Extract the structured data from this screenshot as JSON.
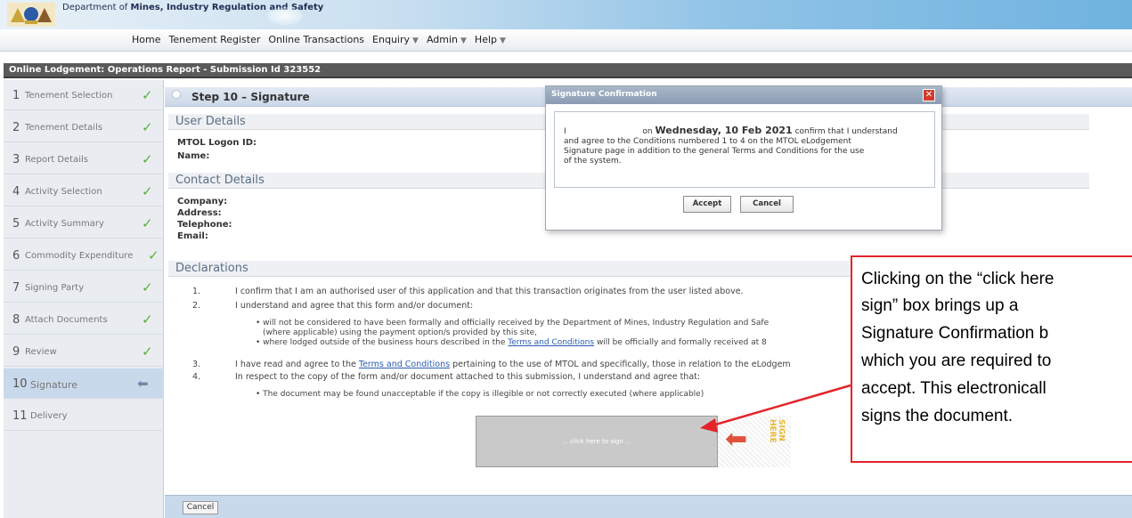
{
  "banner": {
    "dept_prefix": "Department of",
    "dept_name": "Mines, Industry Regulation and Safety"
  },
  "nav": {
    "items": [
      "Home",
      "Tenement Register",
      "Online Transactions",
      "Enquiry",
      "Admin",
      "Help"
    ]
  },
  "title": "Online Lodgement: Operations Report - Submission Id 323552",
  "sidebar": {
    "steps": [
      {
        "num": "1",
        "label": "Tenement Selection"
      },
      {
        "num": "2",
        "label": "Tenement Details"
      },
      {
        "num": "3",
        "label": "Report Details"
      },
      {
        "num": "4",
        "label": "Activity Selection"
      },
      {
        "num": "5",
        "label": "Activity Summary"
      },
      {
        "num": "6",
        "label": "Commodity Expenditure"
      },
      {
        "num": "7",
        "label": "Signing Party"
      },
      {
        "num": "8",
        "label": "Attach Documents"
      },
      {
        "num": "9",
        "label": "Review"
      },
      {
        "num": "10",
        "label": "Signature"
      },
      {
        "num": "11",
        "label": "Delivery"
      }
    ]
  },
  "main": {
    "step_heading": "Step 10 – Signature",
    "user_details": {
      "heading": "User Details",
      "logon_label": "MTOL Logon ID:",
      "name_label": "Name:"
    },
    "contact_details": {
      "heading": "Contact Details",
      "company_label": "Company:",
      "address_label": "Address:",
      "telephone_label": "Telephone:",
      "email_label": "Email:"
    },
    "declarations": {
      "heading": "Declarations",
      "n1": "1.",
      "d1": "I confirm that I am an authorised user of this application and that this transaction originates from the user listed above.",
      "n2": "2.",
      "d2": "I understand and agree that this form and/or document:",
      "b1": "• will not be considered to have been formally and officially received by the Department of Mines, Industry Regulation and Safe",
      "b1b": "(where applicable) using the payment option/s provided by this site,",
      "b2_pre": "• where lodged outside of the business hours described in the ",
      "b2_link": "Terms and Conditions",
      "b2_post": " will be officially and formally received at 8",
      "n3": "3.",
      "d3_pre": "I have read and agree to the ",
      "d3_link": "Terms and Conditions",
      "d3_post": " pertaining to the use of MTOL and specifically, those in relation to the eLodgem",
      "n4": "4.",
      "d4": "In respect to the copy of the form and/or document attached to this submission, I understand and agree that:",
      "b3": "• The document may be found unacceptable if the copy is illegible or not correctly executed (where applicable)"
    },
    "sign_box": "... click here to sign ...",
    "sign_graphic_text": "SIGN HERE",
    "cancel_label": "Cancel"
  },
  "modal": {
    "title": "Signature Confirmation",
    "line1_pre": "I",
    "line1_mid": "on",
    "line1_date": "Wednesday, 10 Feb 2021",
    "line1_post": "confirm that I understand",
    "line2": "and agree to the Conditions numbered 1 to 4 on the MTOL eLodgement",
    "line3": "Signature page in addition to the general Terms and Conditions for the use",
    "line4": "of the system.",
    "accept_label": "Accept",
    "cancel_label": "Cancel"
  },
  "callout": {
    "lines": [
      "Clicking on the “click here",
      "sign” box brings up a",
      "Signature Confirmation b",
      "which you are required to",
      "accept.  This electronicall",
      "signs the document."
    ]
  },
  "colors": {
    "accent_red": "#e3242b",
    "check_green": "#5db03b",
    "link_blue": "#2a5db0"
  }
}
